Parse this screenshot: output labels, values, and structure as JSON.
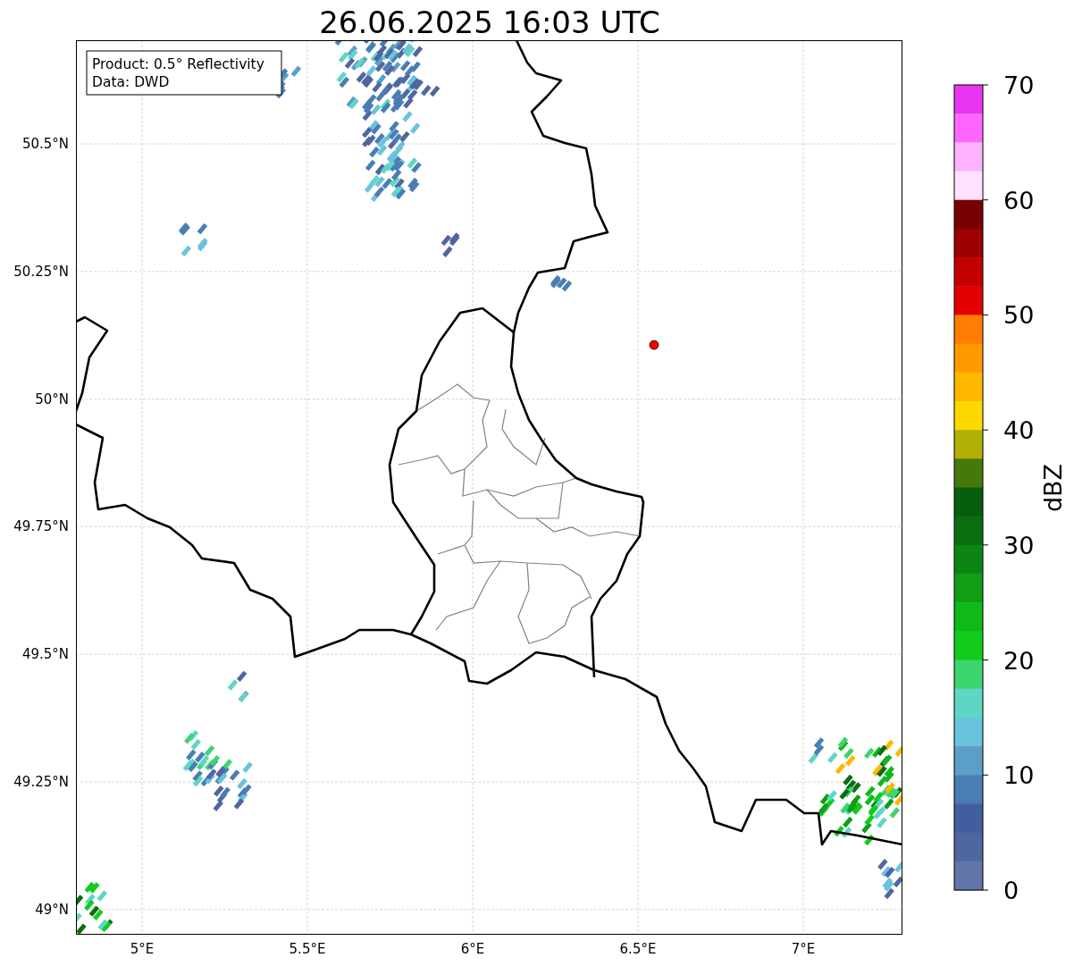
{
  "title": "26.06.2025 16:03 UTC",
  "annotation": [
    "Product: 0.5° Reflectivity",
    "Data: DWD"
  ],
  "x_ticks": [
    "5°E",
    "5.5°E",
    "6°E",
    "6.5°E",
    "7°E"
  ],
  "y_ticks": [
    "50.5°N",
    "50.25°N",
    "50°N",
    "49.75°N",
    "49.5°N",
    "49.25°N",
    "49°N"
  ],
  "colorbar": {
    "label": "dBZ",
    "ticks": [
      "70",
      "60",
      "50",
      "40",
      "30",
      "20",
      "10",
      "0"
    ],
    "colors": [
      {
        "color": "#e835ef"
      },
      {
        "color": "#ff66ff"
      },
      {
        "color": "#ffb3ff"
      },
      {
        "color": "#ffe0ff"
      },
      {
        "color": "#780000"
      },
      {
        "color": "#9c0000"
      },
      {
        "color": "#c20000"
      },
      {
        "color": "#e30000"
      },
      {
        "color": "#ff7d00"
      },
      {
        "color": "#ff9b00"
      },
      {
        "color": "#ffb700"
      },
      {
        "color": "#ffd800"
      },
      {
        "color": "#b0b005"
      },
      {
        "color": "#46780a"
      },
      {
        "color": "#075e0d"
      },
      {
        "color": "#0a6e10"
      },
      {
        "color": "#0d8514"
      },
      {
        "color": "#0f9e16"
      },
      {
        "color": "#10b81a"
      },
      {
        "color": "#12cc1c"
      },
      {
        "color": "#3dd66e"
      },
      {
        "color": "#5fd6c3"
      },
      {
        "color": "#69c3dc"
      },
      {
        "color": "#5a9fc8"
      },
      {
        "color": "#4a7db4"
      },
      {
        "color": "#405ea0"
      },
      {
        "color": "#5066a0"
      },
      {
        "color": "#6275a8"
      }
    ]
  }
}
